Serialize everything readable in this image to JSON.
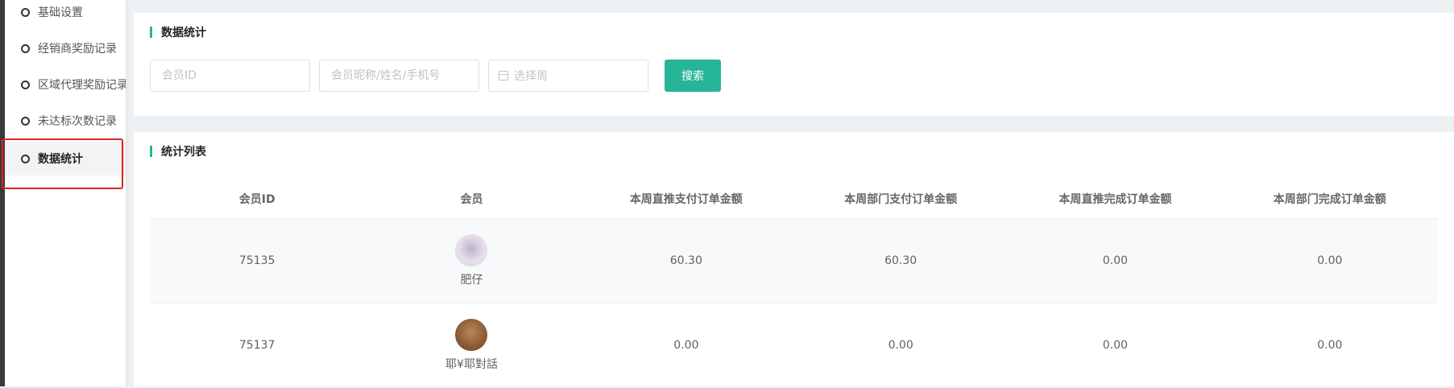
{
  "sidebar": {
    "items": [
      {
        "label": "基础设置"
      },
      {
        "label": "经销商奖励记录"
      },
      {
        "label": "区域代理奖励记录"
      },
      {
        "label": "未达标次数记录"
      },
      {
        "label": "数据统计"
      }
    ]
  },
  "filter": {
    "title": "数据统计",
    "member_id_placeholder": "会员ID",
    "member_info_placeholder": "会员昵称/姓名/手机号",
    "week_placeholder": "选择周",
    "search_label": "搜索"
  },
  "list": {
    "title": "统计列表",
    "columns": [
      "会员ID",
      "会员",
      "本周直推支付订单金额",
      "本周部门支付订单金额",
      "本周直推完成订单金额",
      "本周部门完成订单金额"
    ],
    "rows": [
      {
        "id": "75135",
        "name": "肥仔",
        "direct_pay": "60.30",
        "dept_pay": "60.30",
        "direct_done": "0.00",
        "dept_done": "0.00"
      },
      {
        "id": "75137",
        "name": "耶¥耶對話",
        "direct_pay": "0.00",
        "dept_pay": "0.00",
        "direct_done": "0.00",
        "dept_done": "0.00"
      }
    ]
  },
  "colors": {
    "accent": "#26b597",
    "highlight": "#e02020"
  }
}
